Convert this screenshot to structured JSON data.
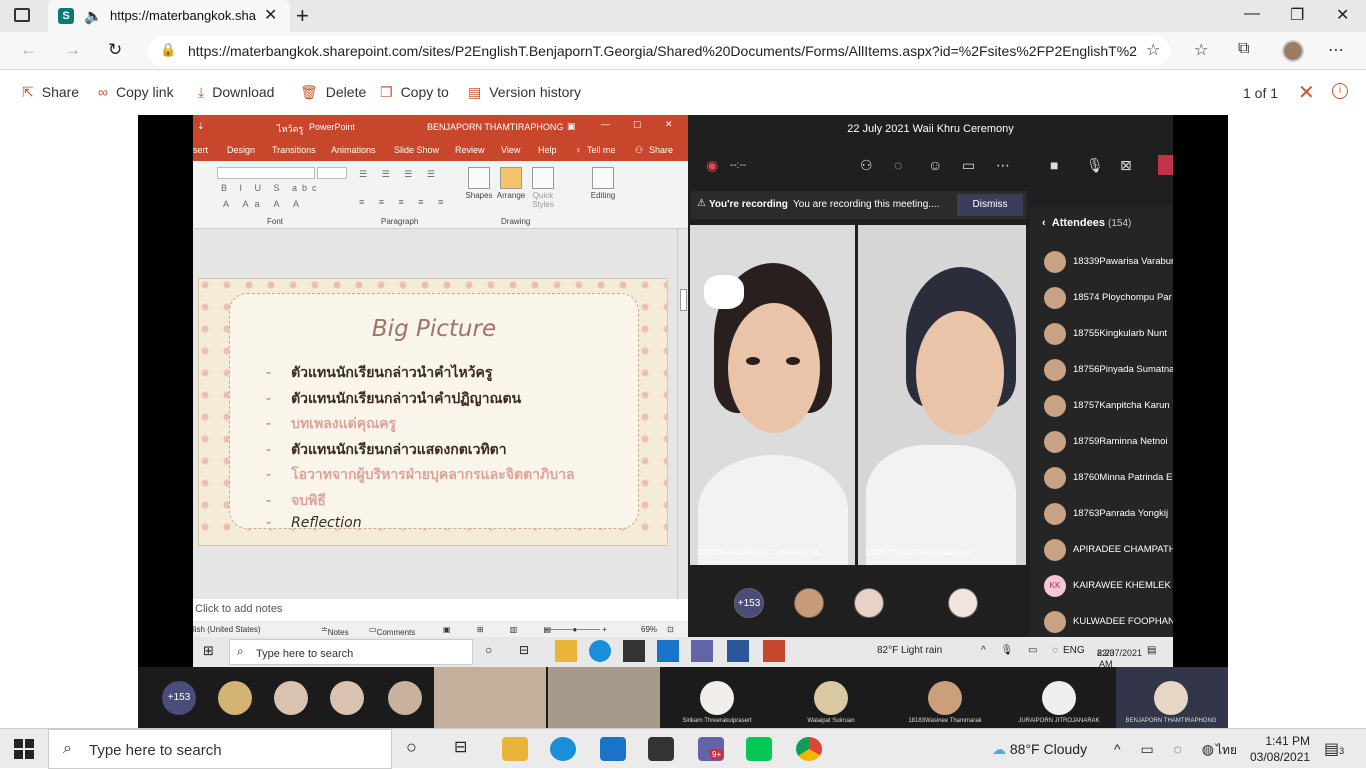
{
  "browser": {
    "tab_title": "https://materbangkok.share",
    "url": "https://materbangkok.sharepoint.com/sites/P2EnglishT.BenjapornT.Georgia/Shared%20Documents/Forms/AllItems.aspx?id=%2Fsites%2FP2EnglishT%2..."
  },
  "toolbar": {
    "share": "Share",
    "copy_link": "Copy link",
    "download": "Download",
    "delete": "Delete",
    "copy_to": "Copy to",
    "version_history": "Version history",
    "pager": "1 of 1"
  },
  "ppt": {
    "title_file": "ไหว้ครู",
    "title_app": "PowerPoint",
    "user": "BENJAPORN THAMTIRAPHONG",
    "tabs": [
      "sert",
      "Design",
      "Transitions",
      "Animations",
      "Slide Show",
      "Review",
      "View",
      "Help",
      "Tell me",
      "Share"
    ],
    "groups": [
      "Font",
      "Paragraph",
      "Drawing"
    ],
    "ribbon_buttons": [
      "Shapes",
      "Arrange",
      "Quick Styles",
      "Editing"
    ],
    "slide_title": "Big Picture",
    "bullets": [
      "ตัวแทนนักเรียนกล่าวนำคำไหว้ครู",
      "ตัวแทนนักเรียนกล่าวนำคำปฏิญาณตน",
      "บทเพลงแด่คุณครู",
      "ตัวแทนนักเรียนกล่าวแสดงกตเวทิตา",
      "โอวาทจากผู้บริหารฝ่ายบุคลากรและจิตตาภิบาล",
      "จบพิธี",
      "Reflection"
    ],
    "notes_placeholder": "Click to add notes",
    "status_lang": "lish (United States)",
    "status_notes": "Notes",
    "status_comments": "Comments",
    "zoom": "69%"
  },
  "teams": {
    "meeting_title": "22 July 2021 Waii Khru Ceremony",
    "rec_time": "--:--",
    "recording_label": "You're recording",
    "recording_text": "You are recording this meeting....",
    "dismiss": "Dismiss",
    "tile1_name": "18322Geeratchaya Catherine At...",
    "tile2_name": "18075Thitipa Treeyapompan",
    "attendees_label": "Attendees",
    "attendees_count": "(154)",
    "attendees": [
      "18339Pawarisa Varabun",
      "18574 Ploychompu Par",
      "18755Kingkularb Nunt",
      "18756Pinyada Sumatna",
      "18757Kanpitcha Karun",
      "18759Raminna Netnoi",
      "18760Minna Patrinda E",
      "18763Panrada Yongkij",
      "APIRADEE CHAMPATHI",
      "KAIRAWEE KHEMLEK",
      "KULWADEE FOOPHAN"
    ],
    "kk_initials": "KK",
    "more_count": "+153"
  },
  "inner_taskbar": {
    "search": "Type here to search",
    "weather": "82°F  Light rain",
    "lang": "ENG",
    "time": "8:23 AM",
    "date": "22/07/2021"
  },
  "gallery": {
    "more_count": "+153",
    "names": [
      "Sirikarn Threerakulprasert",
      "Walaipat Sukruan",
      "18183Wasinee Thammarak",
      "JURAIPORN JITROJANARAK",
      "BENJAPORN THAMTIRAPHONG"
    ]
  },
  "taskbar": {
    "search": "Type here to search",
    "weather": "88°F  Cloudy",
    "lang": "ไทย",
    "time": "1:41 PM",
    "date": "03/08/2021",
    "teams_badge": "9+",
    "notif_count": "3"
  }
}
